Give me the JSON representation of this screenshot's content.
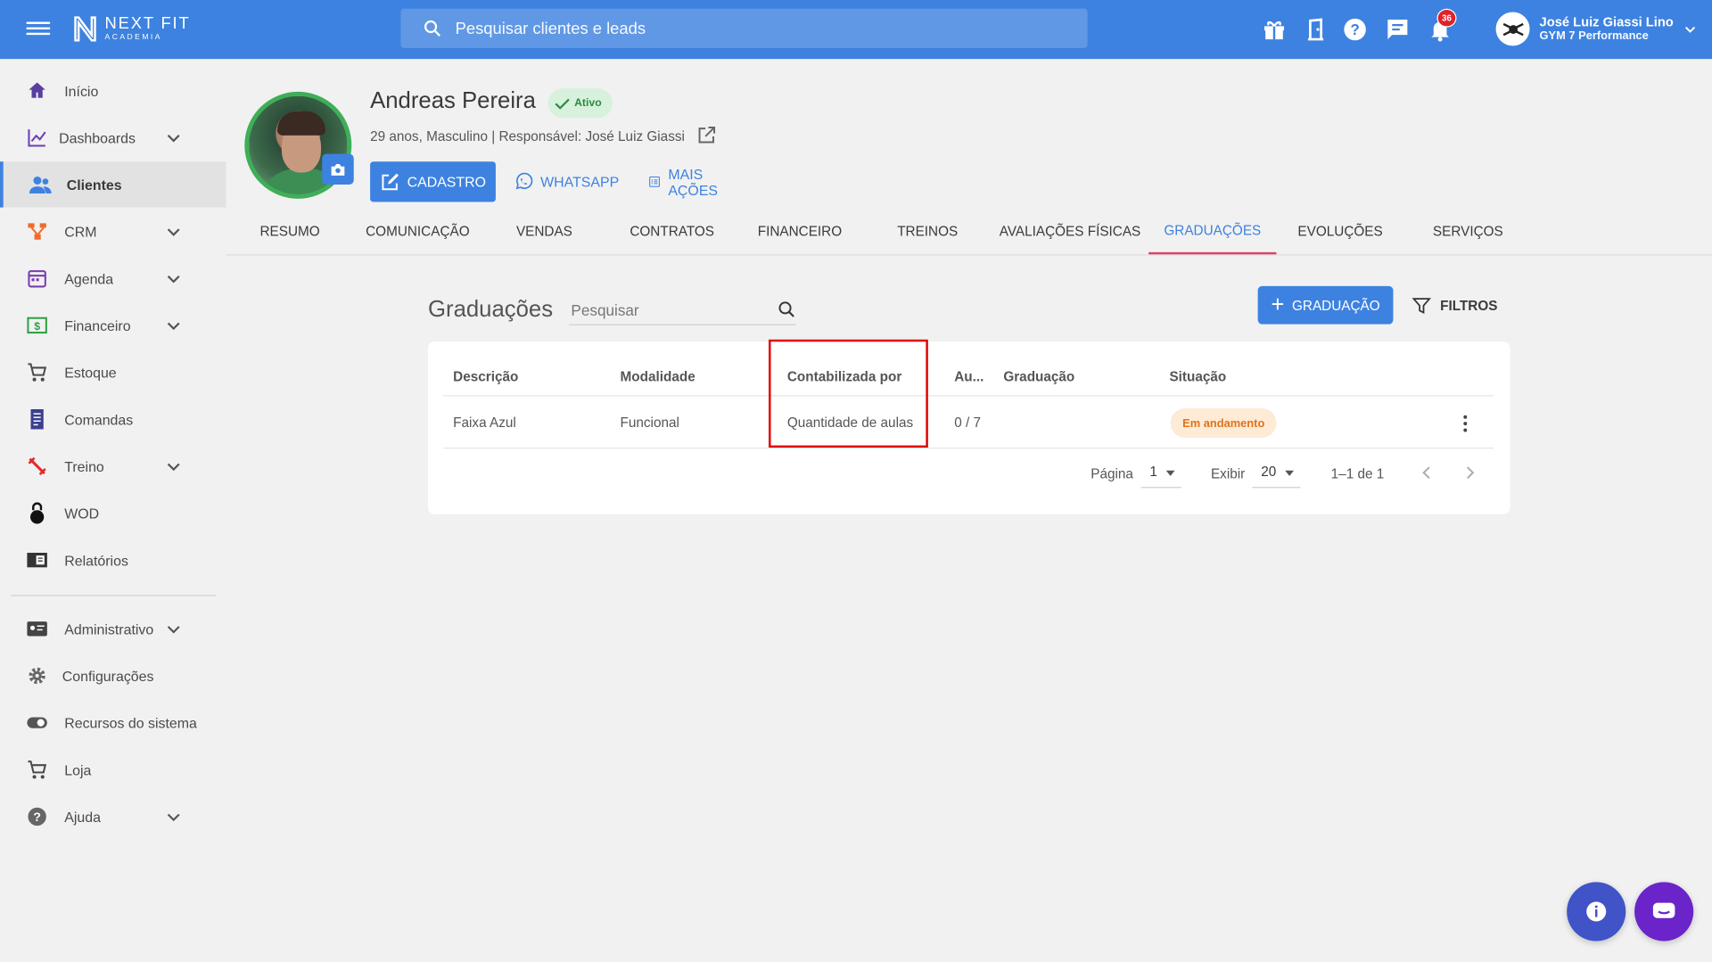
{
  "app": {
    "logo_line1": "NEXT FIT",
    "logo_line2": "ACADEMIA",
    "accent": "#3d82e0"
  },
  "search": {
    "placeholder": "Pesquisar clientes e leads"
  },
  "notifications": {
    "count": "36"
  },
  "user": {
    "name": "José Luiz Giassi Lino",
    "gym": "GYM 7 Performance"
  },
  "sidebar": {
    "items": [
      {
        "label": "Início",
        "icon": "home-icon"
      },
      {
        "label": "Dashboards",
        "icon": "chart-line-icon"
      },
      {
        "label": "Clientes",
        "icon": "people-icon"
      },
      {
        "label": "CRM",
        "icon": "crm-icon"
      },
      {
        "label": "Agenda",
        "icon": "calendar-icon"
      },
      {
        "label": "Financeiro",
        "icon": "money-icon"
      },
      {
        "label": "Estoque",
        "icon": "cart-icon"
      },
      {
        "label": "Comandas",
        "icon": "receipt-icon"
      },
      {
        "label": "Treino",
        "icon": "dumbbell-icon"
      },
      {
        "label": "WOD",
        "icon": "kettlebell-icon"
      },
      {
        "label": "Relatórios",
        "icon": "report-icon"
      },
      {
        "label": "Administrativo",
        "icon": "id-card-icon"
      },
      {
        "label": "Configurações",
        "icon": "gear-icon"
      },
      {
        "label": "Recursos do sistema",
        "icon": "toggle-icon"
      },
      {
        "label": "Loja",
        "icon": "cart-icon"
      },
      {
        "label": "Ajuda",
        "icon": "help-icon"
      }
    ]
  },
  "profile": {
    "name": "Andreas Pereira",
    "status": "Ativo",
    "info": "29 anos, Masculino | Responsável: José Luiz Giassi",
    "btn_cadastro": "CADASTRO",
    "btn_whatsapp": "WHATSAPP",
    "btn_mais": "MAIS AÇÕES"
  },
  "tabs": [
    "RESUMO",
    "COMUNICAÇÃO",
    "VENDAS",
    "CONTRATOS",
    "FINANCEIRO",
    "TREINOS",
    "AVALIAÇÕES FÍSICAS",
    "GRADUAÇÕES",
    "EVOLUÇÕES",
    "SERVIÇOS"
  ],
  "section": {
    "title": "Graduações",
    "search_placeholder": "Pesquisar",
    "btn_add": "GRADUAÇÃO",
    "btn_filter": "FILTROS"
  },
  "table": {
    "headers": [
      "Descrição",
      "Modalidade",
      "Contabilizada por",
      "Au...",
      "Graduação",
      "Situação"
    ],
    "rows": [
      {
        "descricao": "Faixa Azul",
        "modalidade": "Funcional",
        "contabilizada": "Quantidade de aulas",
        "aulas": "0 / 7",
        "graduacao": "",
        "situacao": "Em andamento"
      }
    ]
  },
  "pagination": {
    "page_label": "Página",
    "page": "1",
    "show_label": "Exibir",
    "per_page": "20",
    "range": "1–1 de 1"
  }
}
